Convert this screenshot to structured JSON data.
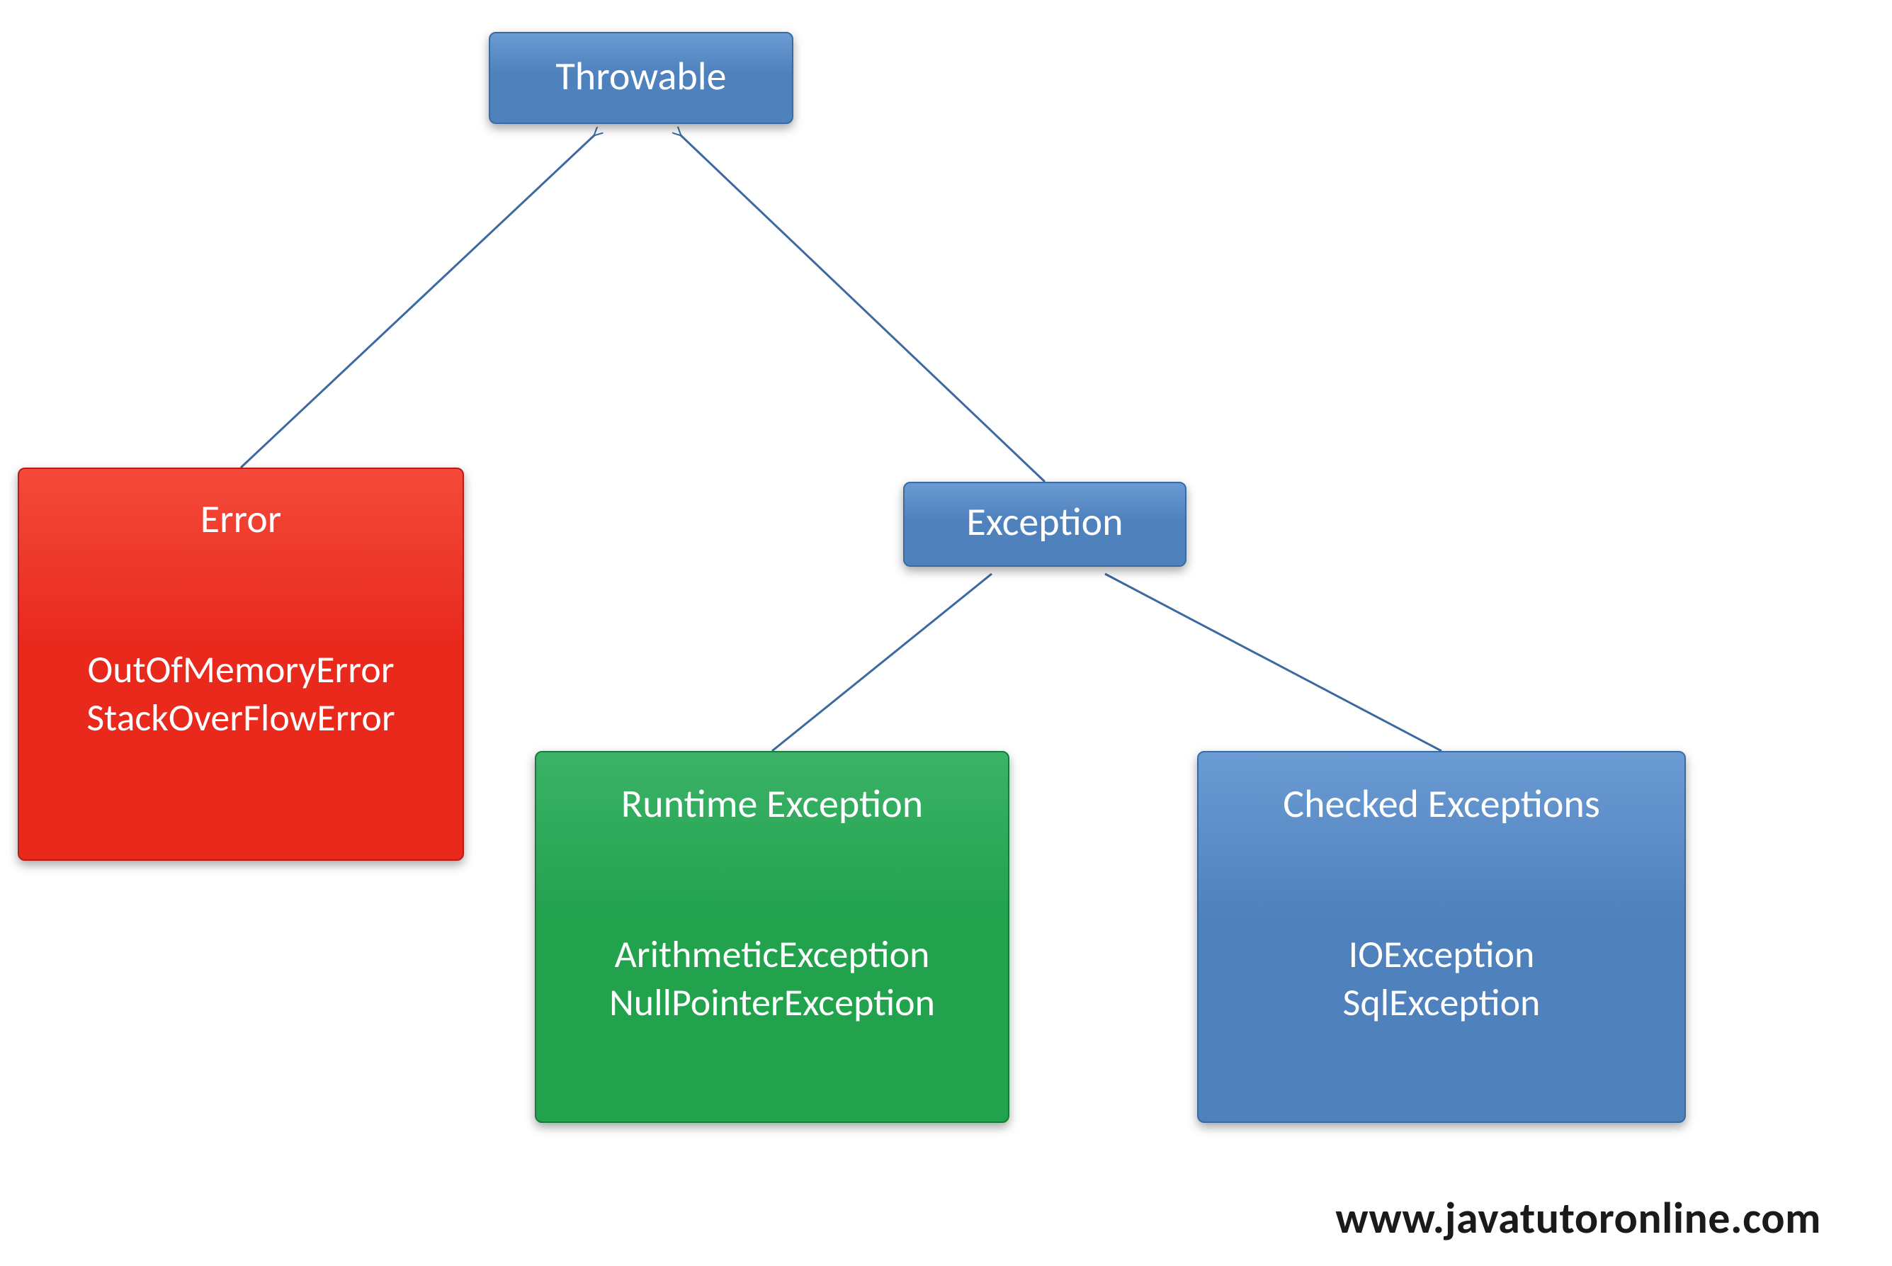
{
  "root": {
    "label": "Throwable"
  },
  "error": {
    "label": "Error",
    "examples": "OutOfMemoryError\nStackOverFlowError"
  },
  "exception": {
    "label": "Exception"
  },
  "runtime": {
    "label": "Runtime Exception",
    "examples": "ArithmeticException\nNullPointerException"
  },
  "checked": {
    "label": "Checked Exceptions",
    "examples": "IOException\nSqlException"
  },
  "watermark": "www.javatutoronline.com",
  "colors": {
    "blue": "#4f81bd",
    "red": "#e8291c",
    "green": "#22a24d",
    "connector": "#3b6aa0"
  }
}
